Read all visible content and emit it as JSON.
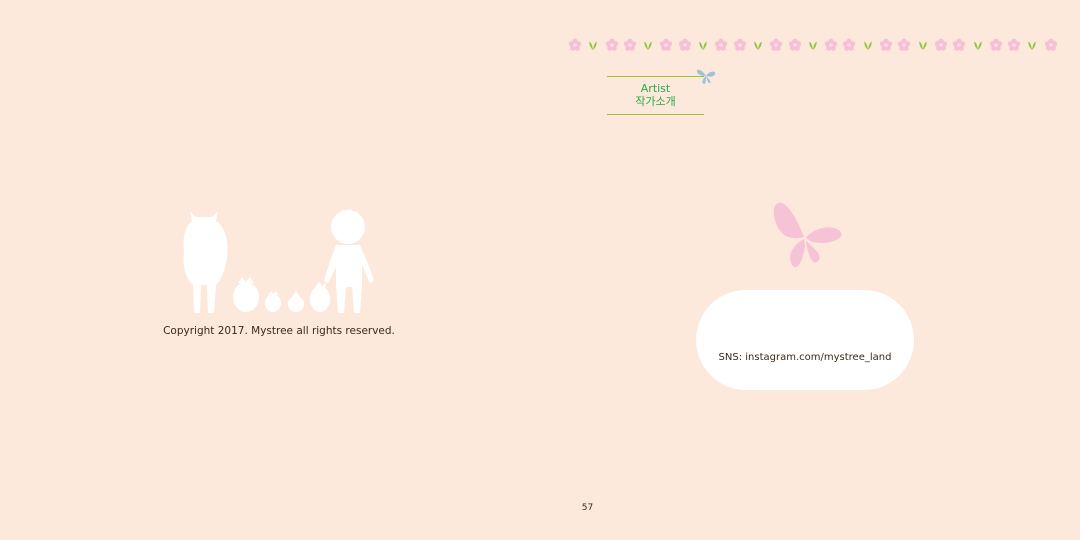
{
  "left_page": {
    "copyright": "Copyright 2017. Mystree all rights reserved."
  },
  "right_page": {
    "heading_en": "Artist",
    "heading_ko": "작가소개",
    "sns": "SNS: instagram.com/mystree_land"
  },
  "page_number": "57",
  "colors": {
    "background": "#fde8dc",
    "flower": "#f6bfd3",
    "sprout": "#8dc63f",
    "heading_text": "#2ca84a",
    "small_butterfly": "#9cc3d6",
    "big_butterfly": "#f6c3d6",
    "text": "#3a2a1a",
    "silhouette": "#ffffff"
  },
  "icons": [
    "flower-icon",
    "sprout-icon",
    "butterfly-icon",
    "character-silhouettes"
  ]
}
